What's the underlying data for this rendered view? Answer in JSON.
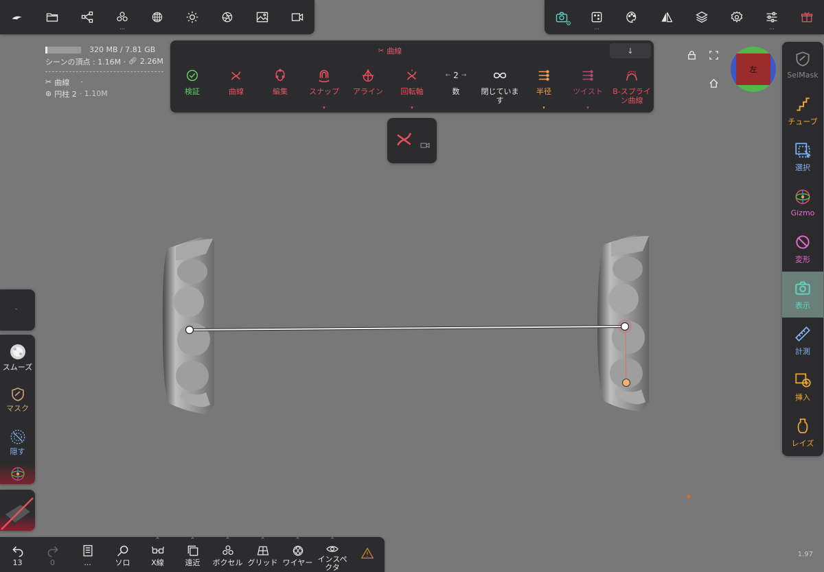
{
  "top_left_toolbar": {
    "icons": [
      "sculpt-logo-icon",
      "folder-icon",
      "scene-graph-icon",
      "voxel-icon",
      "sphere-mesh-icon",
      "light-icon",
      "aperture-icon",
      "image-icon",
      "video-icon"
    ]
  },
  "top_right_toolbar": {
    "icons": [
      "camera-icon",
      "dice-icon",
      "palette-icon",
      "symmetry-icon",
      "layers-icon",
      "settings-icon",
      "sliders-icon",
      "gift-icon"
    ]
  },
  "scene_info": {
    "memory": "320 MB / 7.81 GB",
    "vertices": "シーンの頂点 : 1.16M · ",
    "vertices_extra": "2.26M",
    "selected_tool": "曲線",
    "selected_tool_suffix": "·",
    "object": "円柱 2",
    "object_detail": "· 1.10M"
  },
  "curve_panel": {
    "title": "曲線",
    "collapse_label": "↓",
    "buttons": [
      {
        "label": "検証",
        "color": "#5fcf62"
      },
      {
        "label": "曲線",
        "color": "#e8505e"
      },
      {
        "label": "編集",
        "color": "#e8505e"
      },
      {
        "label": "スナップ",
        "color": "#e8505e"
      },
      {
        "label": "アライン",
        "color": "#e8505e"
      },
      {
        "label": "回転軸",
        "color": "#e8505e"
      },
      {
        "label": "数",
        "value": "2",
        "color": "#e8e8e8"
      },
      {
        "label": "閉じています",
        "color": "#e8e8e8"
      },
      {
        "label": "半径",
        "color": "#f0a050"
      },
      {
        "label": "ツイスト",
        "color": "#b04a70"
      },
      {
        "label": "B-スプライ ン曲線",
        "color": "#e8505e"
      }
    ]
  },
  "viewcube": {
    "label": "左",
    "colors": {
      "center": "#9b2c2c",
      "top": "#52b84a",
      "left": "#3c58c8",
      "right": "#3c58c8"
    }
  },
  "right_bar": {
    "items": [
      {
        "label": "SelMask",
        "color": "#8a8a8a"
      },
      {
        "label": "チューブ",
        "color": "#f0a732"
      },
      {
        "label": "選択",
        "color": "#7fb2f0"
      },
      {
        "label": "Gizmo",
        "color": "#e86ad0"
      },
      {
        "label": "変形",
        "color": "#e86ad0"
      },
      {
        "label": "表示",
        "color": "#5cd6c0"
      },
      {
        "label": "計測",
        "color": "#7fb2f0"
      },
      {
        "label": "挿入",
        "color": "#f0a732"
      },
      {
        "label": "レイズ",
        "color": "#f0a732"
      }
    ]
  },
  "left_tools": {
    "top_label": "-",
    "items": [
      {
        "label": "スムーズ",
        "color": "#e8e8e8"
      },
      {
        "label": "マスク",
        "color": "#c8a878"
      },
      {
        "label": "隠す",
        "color": "#7fb2f0"
      }
    ]
  },
  "bottom_bar": {
    "items": [
      {
        "label": "13",
        "icon": "undo-icon"
      },
      {
        "label": "0",
        "icon": "redo-icon"
      },
      {
        "label": "...",
        "icon": "book-icon"
      },
      {
        "label": "ソロ",
        "icon": "search-icon"
      },
      {
        "label": "X線",
        "icon": "glasses-icon"
      },
      {
        "label": "遠近",
        "icon": "perspective-icon"
      },
      {
        "label": "ボクセル",
        "icon": "voxel-icon"
      },
      {
        "label": "グリッド",
        "icon": "grid-icon"
      },
      {
        "label": "ワイヤー",
        "icon": "wireframe-icon"
      },
      {
        "label": "インスペクタ",
        "icon": "eye-icon"
      },
      {
        "label": "",
        "icon": "warning-icon"
      }
    ]
  },
  "version": "1.97"
}
